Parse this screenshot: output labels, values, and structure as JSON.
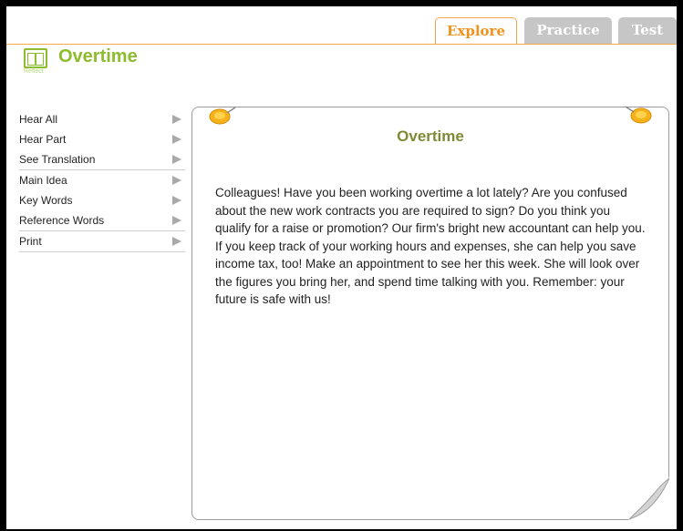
{
  "tabs": {
    "explore": "Explore",
    "practice": "Practice",
    "test": "Test"
  },
  "header": {
    "title": "Overtime",
    "icon_label": "Reflect"
  },
  "sidebar": {
    "items": [
      {
        "label": "Hear All"
      },
      {
        "label": "Hear Part"
      },
      {
        "label": "See Translation"
      },
      {
        "label": "Main Idea"
      },
      {
        "label": "Key Words"
      },
      {
        "label": "Reference Words"
      },
      {
        "label": "Print"
      }
    ]
  },
  "card": {
    "title": "Overtime",
    "body": "Colleagues! Have you been working overtime a lot lately? Are you confused about the new work contracts you are required to sign? Do you think you qualify for a raise or promotion? Our firm's bright new accountant can help you. If you keep track of your working hours and expenses, she can help you save income tax, too! Make an appointment to see her this week. She will look over the figures you bring her, and spend time talking with you. Remember: your future is safe with us!"
  },
  "colors": {
    "accent_orange": "#f0921e",
    "brand_green": "#8dbc2f",
    "title_olive": "#7f8a36",
    "tab_grey": "#c6c6c6"
  }
}
